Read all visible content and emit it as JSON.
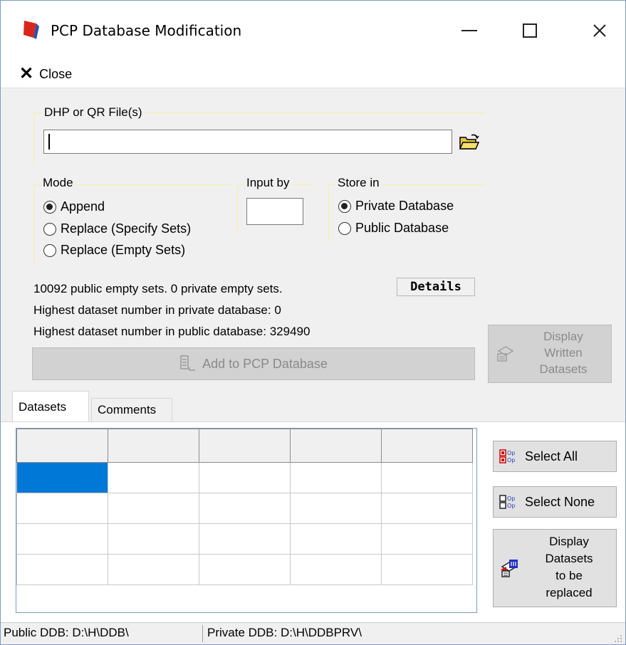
{
  "window": {
    "title": "PCP Database Modification",
    "minimize": "—",
    "maximize": "☐",
    "close": "✕"
  },
  "menu": {
    "close_label": "Close",
    "close_glyph": "✕"
  },
  "file_group": {
    "label": "DHP or QR File(s)",
    "value": ""
  },
  "mode_group": {
    "label": "Mode",
    "options": [
      {
        "label": "Append",
        "selected": true
      },
      {
        "label": "Replace (Specify Sets)",
        "selected": false
      },
      {
        "label": "Replace (Empty Sets)",
        "selected": false
      }
    ]
  },
  "input_by": {
    "label": "Input by",
    "value": ""
  },
  "store_group": {
    "label": "Store in",
    "options": [
      {
        "label": "Private Database",
        "selected": true
      },
      {
        "label": "Public Database",
        "selected": false
      }
    ]
  },
  "info": {
    "empty_sets": "10092 public empty sets. 0 private empty sets.",
    "highest_private": "Highest dataset number in private database: 0",
    "highest_public": "Highest dataset number in public database:  329490"
  },
  "buttons": {
    "details": "Details",
    "add_to_pcp": "Add to PCP Database",
    "display_written": [
      "Display",
      "Written",
      "Datasets"
    ],
    "select_all": "Select All",
    "select_none": "Select None",
    "display_replaced": [
      "Display",
      "Datasets",
      "to be",
      "replaced"
    ]
  },
  "tabs": [
    {
      "label": "Datasets",
      "active": true
    },
    {
      "label": "Comments",
      "active": false
    }
  ],
  "status": {
    "public_ddb": "Public DDB:   D:\\H\\DDB\\",
    "private_ddb": "Private DDB:   D:\\H\\DDBPRV\\"
  },
  "colors": {
    "selection": "#0078d7",
    "frame": "#f5f0a8",
    "disabled_text": "#8a8a8a"
  }
}
